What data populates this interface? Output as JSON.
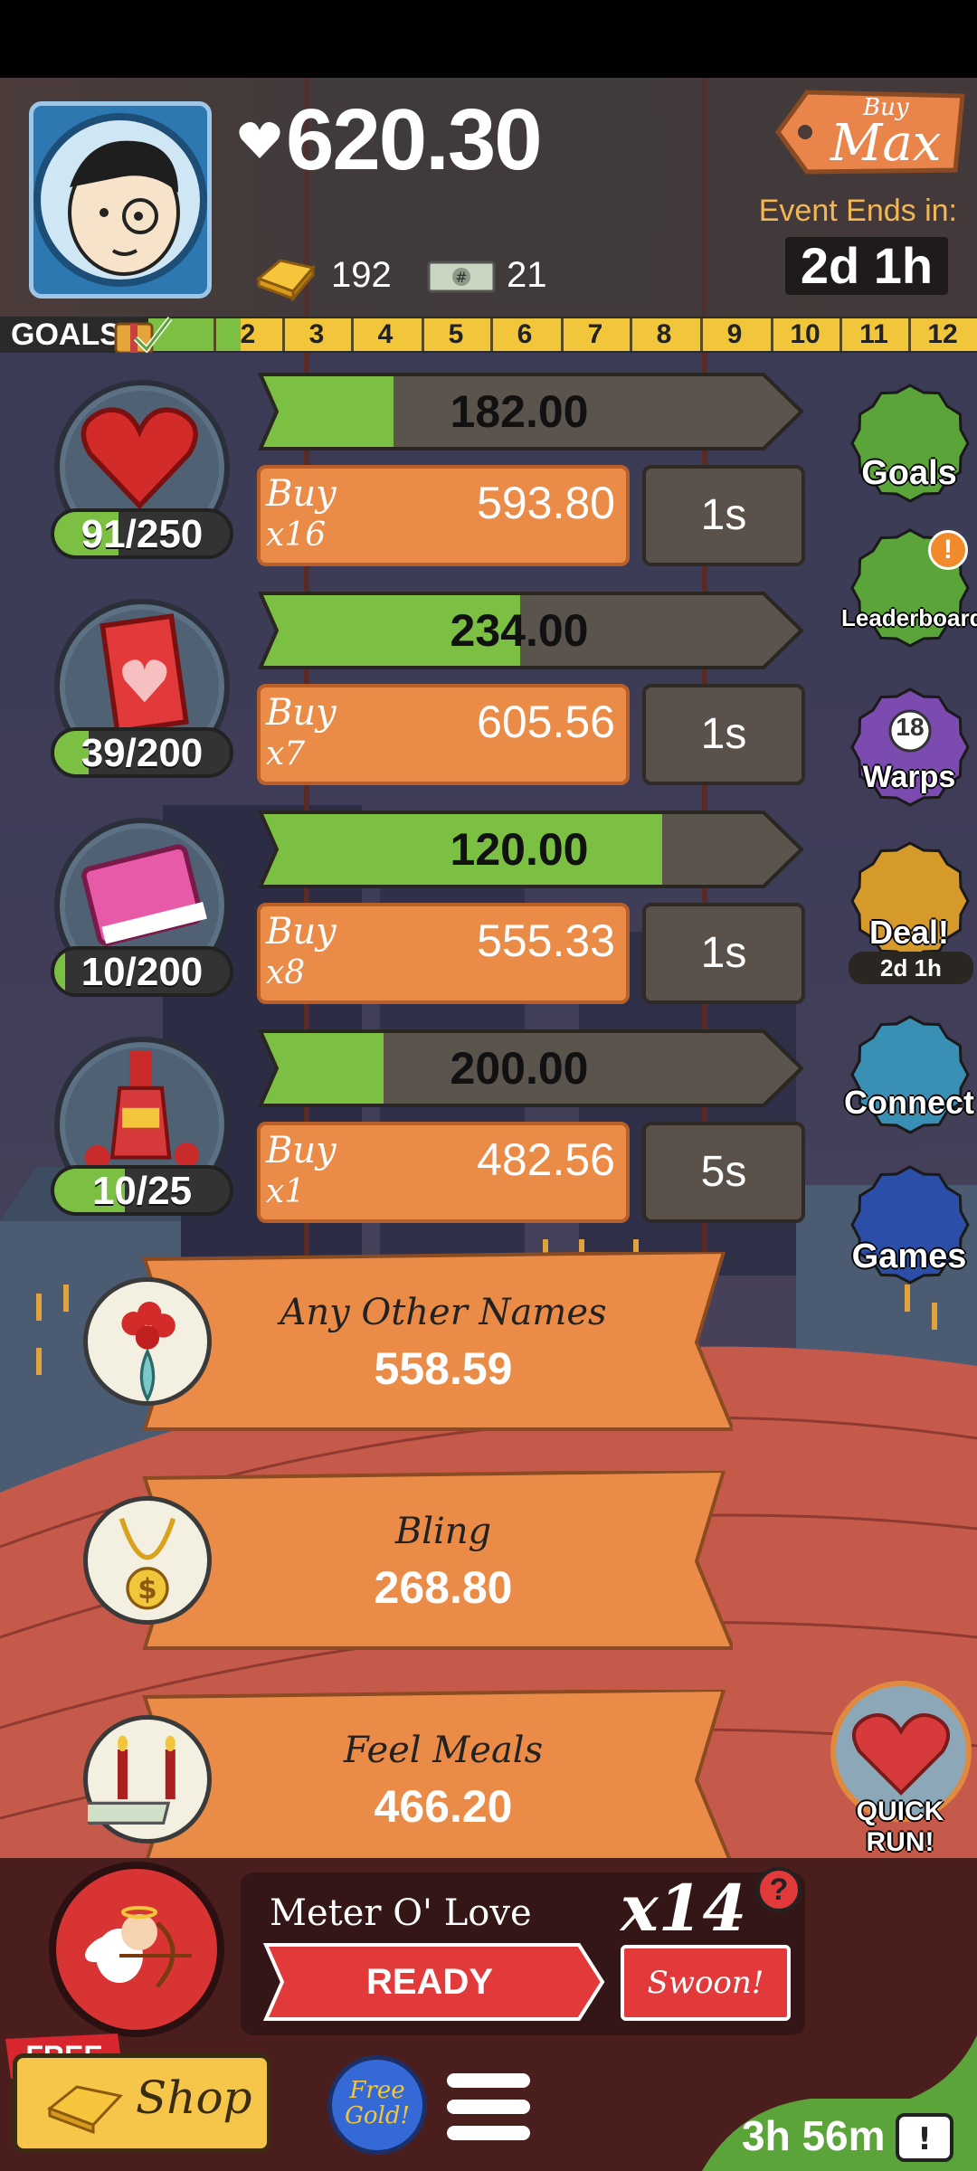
{
  "header": {
    "money": "620.30",
    "gold_count": "192",
    "cash_count": "21",
    "buy_max_top": "Buy",
    "buy_max_bottom": "Max",
    "event_label": "Event Ends in:",
    "event_time": "2d 1h"
  },
  "goals_bar": {
    "label": "GOALS",
    "numbers": [
      "2",
      "3",
      "4",
      "5",
      "6",
      "7",
      "8",
      "9",
      "10",
      "11",
      "12"
    ]
  },
  "businesses": [
    {
      "icon": "heart-chocolate-box-icon",
      "count": "91/250",
      "count_fraction": 0.364,
      "progress_value": "182.00",
      "progress_fraction": 0.27,
      "buy_label": "Buy",
      "buy_mult": "x16",
      "cost": "593.80",
      "time": "1s"
    },
    {
      "icon": "valentine-card-icon",
      "count": "39/200",
      "count_fraction": 0.195,
      "progress_value": "234.00",
      "progress_fraction": 0.52,
      "buy_label": "Buy",
      "buy_mult": "x7",
      "cost": "605.56",
      "time": "1s"
    },
    {
      "icon": "pink-book-icon",
      "count": "10/200",
      "count_fraction": 0.05,
      "progress_value": "120.00",
      "progress_fraction": 0.8,
      "buy_label": "Buy",
      "buy_mult": "x8",
      "cost": "555.33",
      "time": "1s"
    },
    {
      "icon": "hot-sauce-icon",
      "count": "10/25",
      "count_fraction": 0.4,
      "progress_value": "200.00",
      "progress_fraction": 0.25,
      "buy_label": "Buy",
      "buy_mult": "x1",
      "cost": "482.56",
      "time": "5s"
    }
  ],
  "banners": [
    {
      "icon": "rose-vase-icon",
      "title": "Any Other Names",
      "value": "558.59"
    },
    {
      "icon": "bling-necklace-icon",
      "title": "Bling",
      "value": "268.80"
    },
    {
      "icon": "candle-dinner-icon",
      "title": "Feel Meals",
      "value": "466.20"
    }
  ],
  "side_menu": [
    {
      "label": "Goals",
      "icon": "goals-checklist-icon",
      "color": "#5aa43a"
    },
    {
      "label": "Leaderboard",
      "icon": "trophy-icon",
      "color": "#5aa43a"
    },
    {
      "label": "Warps",
      "icon": "warp-clock-icon",
      "color": "#7b4bb0",
      "badge": "18"
    },
    {
      "label": "Deal!",
      "icon": "gift-box-icon",
      "color": "#d69a2a",
      "sub": "2d 1h"
    },
    {
      "label": "Connect",
      "icon": "connect-photos-icon",
      "color": "#3a8fb5"
    },
    {
      "label": "Games",
      "icon": "games-icon",
      "color": "#2b4fa8"
    }
  ],
  "quick_run": {
    "label": "QUICK RUN!"
  },
  "meter": {
    "title": "Meter O' Love",
    "multiplier": "x14",
    "help": "?",
    "ready": "READY",
    "swoon": "Swoon!"
  },
  "bottom": {
    "free_tag": "FREE",
    "shop_label": "Shop",
    "free_gold": "Free Gold!",
    "timer": "3h 56m"
  },
  "colors": {
    "accent_orange": "#ea8b47",
    "progress_green": "#7bc043",
    "gold": "#f2c63b",
    "red": "#e23a3a"
  }
}
